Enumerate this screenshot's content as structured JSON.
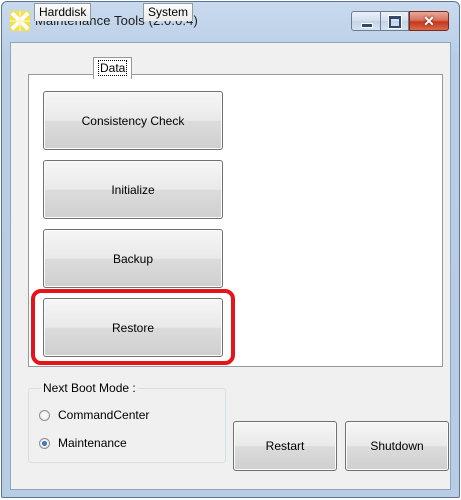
{
  "window": {
    "title": "Maintenance Tools (2.0.0.4)",
    "icon": "yellow-x-app-icon",
    "controls": [
      "minimize",
      "maximize",
      "close"
    ]
  },
  "tabs": [
    {
      "label": "Harddisk",
      "active": false
    },
    {
      "label": "Data",
      "active": true
    },
    {
      "label": "System",
      "active": false
    }
  ],
  "data_tab": {
    "buttons": [
      {
        "label": "Consistency Check",
        "mnemonic": "C"
      },
      {
        "label": "Initialize",
        "mnemonic": "I"
      },
      {
        "label": "Backup",
        "mnemonic": "B"
      },
      {
        "label": "Restore",
        "mnemonic": "R",
        "highlighted": true
      }
    ]
  },
  "boot_mode": {
    "title": "Next Boot Mode :",
    "options": [
      {
        "label": "CommandCenter",
        "checked": false
      },
      {
        "label": "Maintenance",
        "checked": true
      }
    ]
  },
  "footer_buttons": {
    "restart": "Restart",
    "shutdown": "Shutdown"
  },
  "colors": {
    "highlight": "#e5141b",
    "title_bar": "#c9daee"
  }
}
